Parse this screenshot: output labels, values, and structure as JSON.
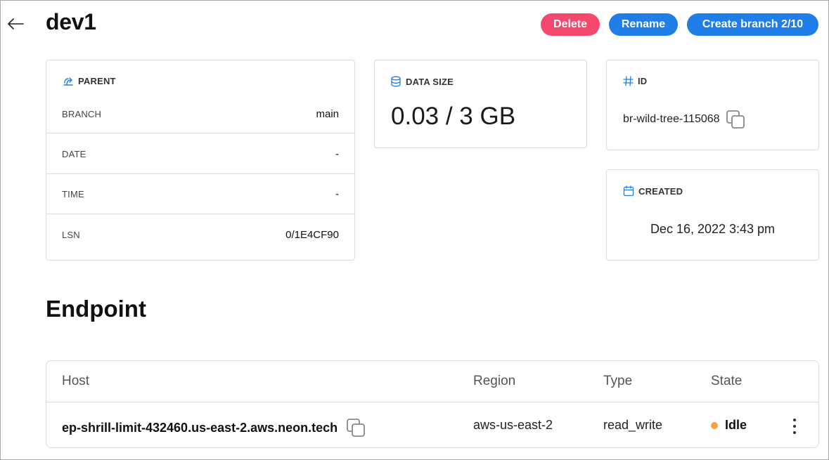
{
  "header": {
    "title": "dev1",
    "back_icon": "arrow-left-icon",
    "actions": {
      "delete_label": "Delete",
      "rename_label": "Rename",
      "create_label": "Create branch 2/10"
    },
    "colors": {
      "delete": "#f5486f",
      "primary": "#1f7ee8"
    }
  },
  "parent": {
    "heading": "PARENT",
    "icon": "branch-icon",
    "rows": [
      {
        "key": "BRANCH",
        "value": "main"
      },
      {
        "key": "DATE",
        "value": "-"
      },
      {
        "key": "TIME",
        "value": "-"
      },
      {
        "key": "LSN",
        "value": "0/1E4CF90"
      }
    ]
  },
  "data_size": {
    "heading": "DATA SIZE",
    "icon": "database-icon",
    "value": "0.03 / 3 GB"
  },
  "id_card": {
    "heading": "ID",
    "icon": "hash-icon",
    "value": "br-wild-tree-115068",
    "copy_icon": "copy-icon"
  },
  "created": {
    "heading": "CREATED",
    "icon": "calendar-icon",
    "value": "Dec 16, 2022 3:43 pm"
  },
  "endpoint": {
    "section_title": "Endpoint",
    "columns": [
      "Host",
      "Region",
      "Type",
      "State"
    ],
    "rows": [
      {
        "host": "ep-shrill-limit-432460.us-east-2.aws.neon.tech",
        "region": "aws-us-east-2",
        "type": "read_write",
        "state": "Idle",
        "state_color": "#f4a340"
      }
    ]
  }
}
